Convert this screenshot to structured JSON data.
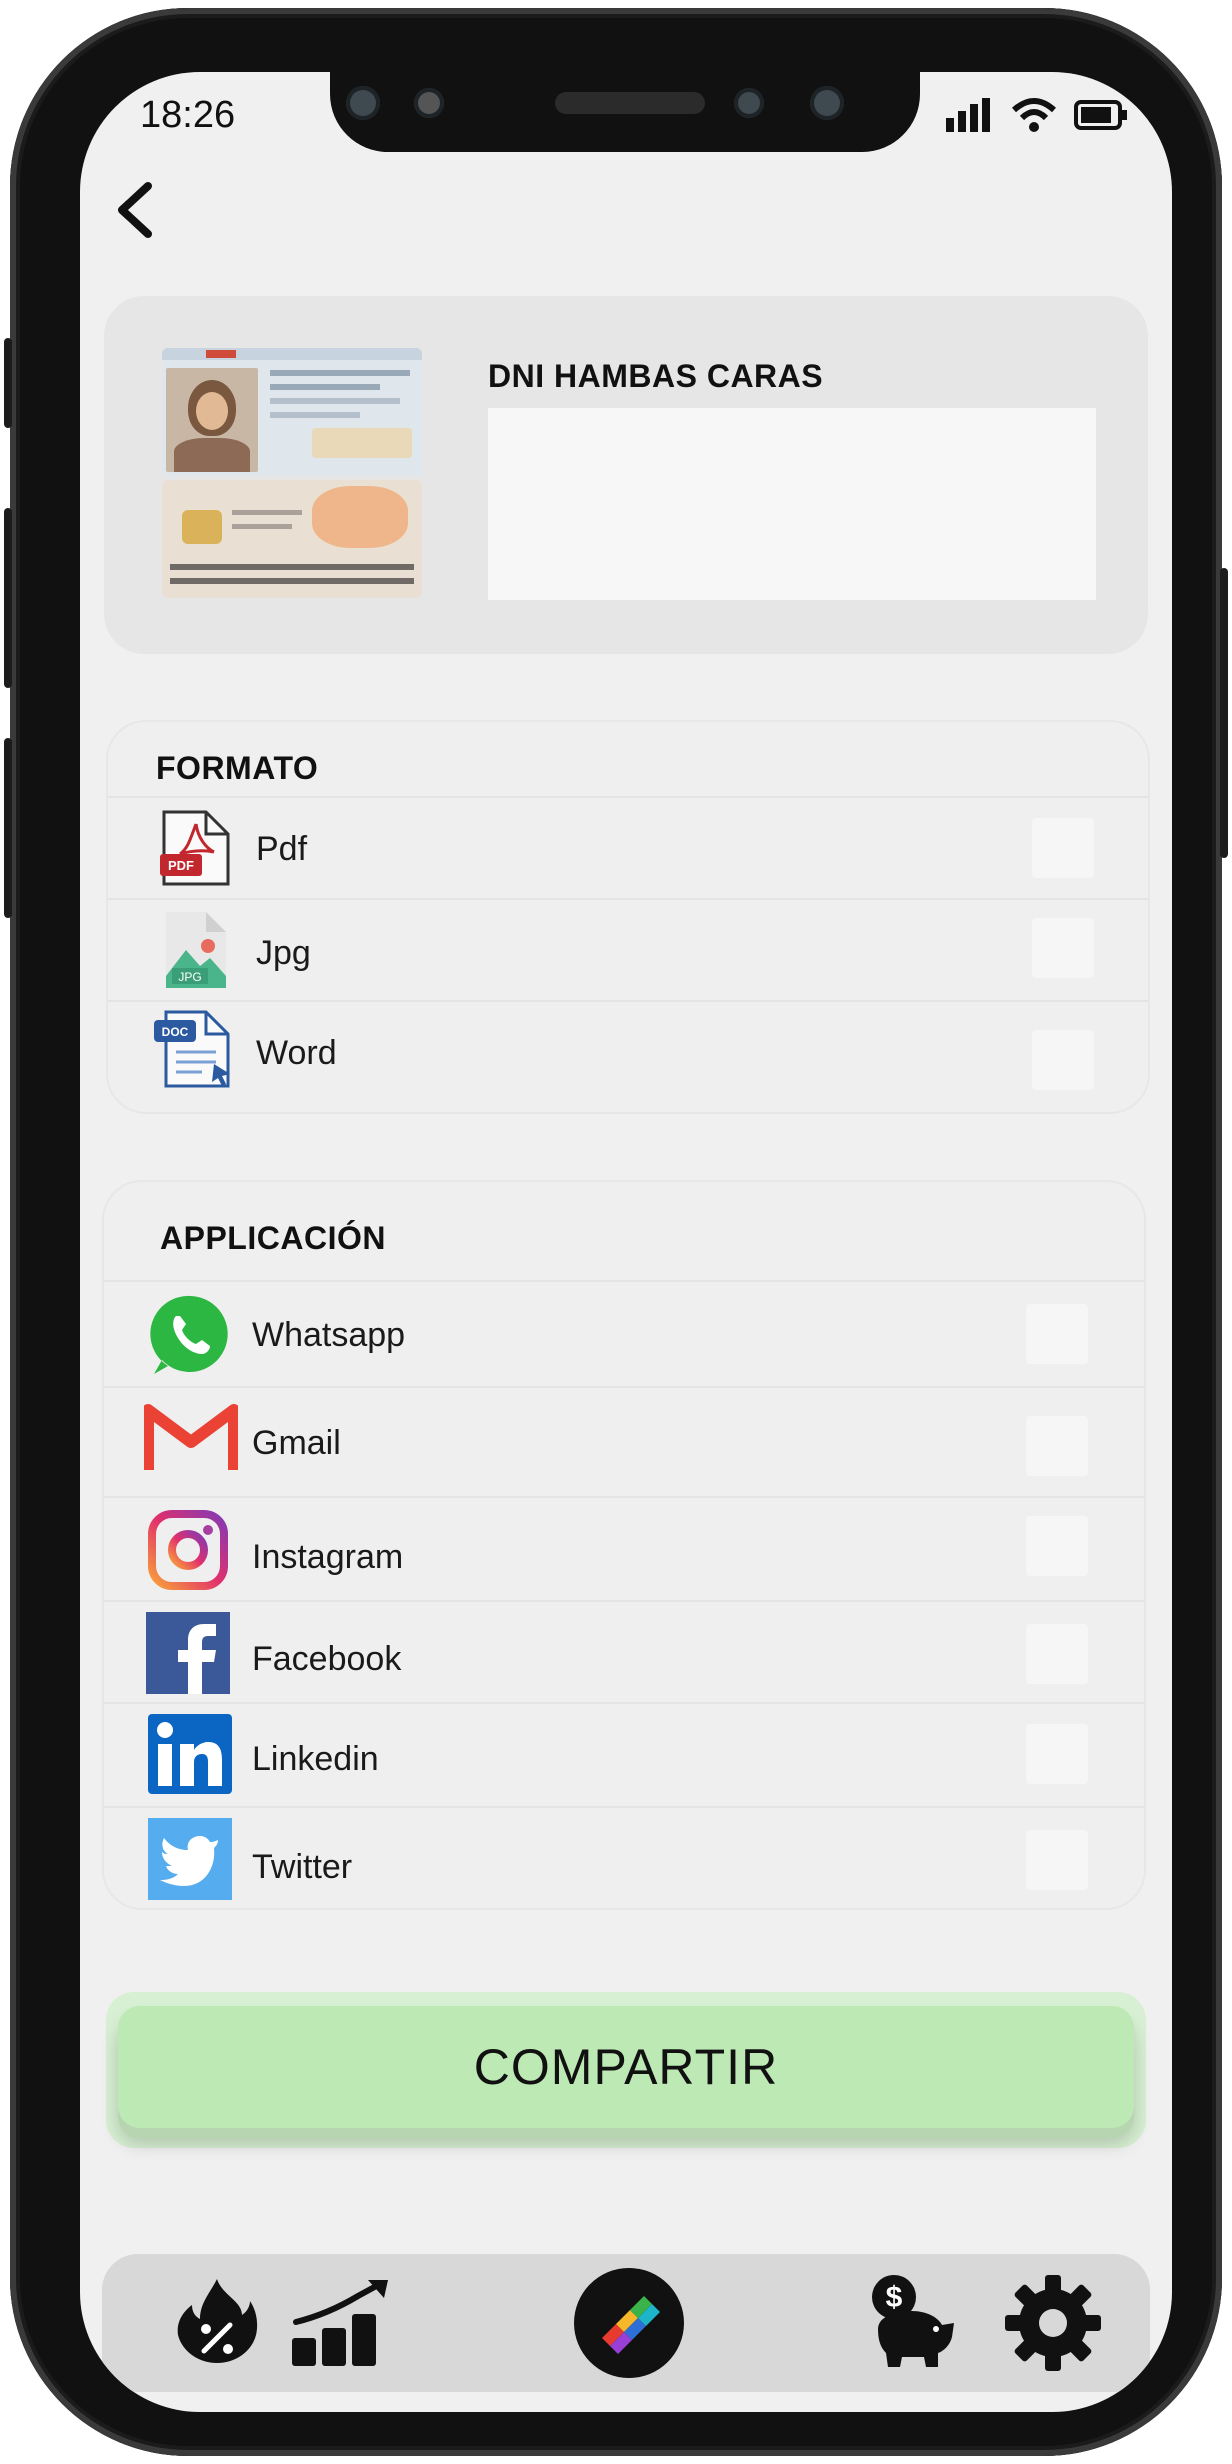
{
  "status_bar": {
    "time": "18:26"
  },
  "document": {
    "label": "DNI HAMBAS CARAS"
  },
  "format_section": {
    "title": "FORMATO",
    "items": [
      {
        "label": "Pdf",
        "icon": "pdf-file-icon",
        "badge": "PDF"
      },
      {
        "label": "Jpg",
        "icon": "jpg-file-icon",
        "badge": "JPG"
      },
      {
        "label": "Word",
        "icon": "doc-file-icon",
        "badge": "DOC"
      }
    ]
  },
  "app_section": {
    "title": "APPLICACIÓN",
    "items": [
      {
        "label": "Whatsapp",
        "icon": "whatsapp-icon"
      },
      {
        "label": "Gmail",
        "icon": "gmail-icon"
      },
      {
        "label": "Instagram",
        "icon": "instagram-icon"
      },
      {
        "label": "Facebook",
        "icon": "facebook-icon"
      },
      {
        "label": "Linkedin",
        "icon": "linkedin-icon"
      },
      {
        "label": "Twitter",
        "icon": "twitter-icon"
      }
    ]
  },
  "share_button": {
    "label": "COMPARTIR"
  },
  "colors": {
    "accent_button": "#bde9b5",
    "whatsapp": "#2bb741",
    "gmail": "#ea4335",
    "facebook": "#3b5998",
    "linkedin": "#0a66c2",
    "twitter": "#55acee"
  },
  "bottom_nav": [
    {
      "icon": "discount-fire-icon"
    },
    {
      "icon": "growth-chart-icon"
    },
    {
      "icon": "app-logo-icon"
    },
    {
      "icon": "savings-piggy-icon"
    },
    {
      "icon": "settings-gear-icon"
    }
  ]
}
